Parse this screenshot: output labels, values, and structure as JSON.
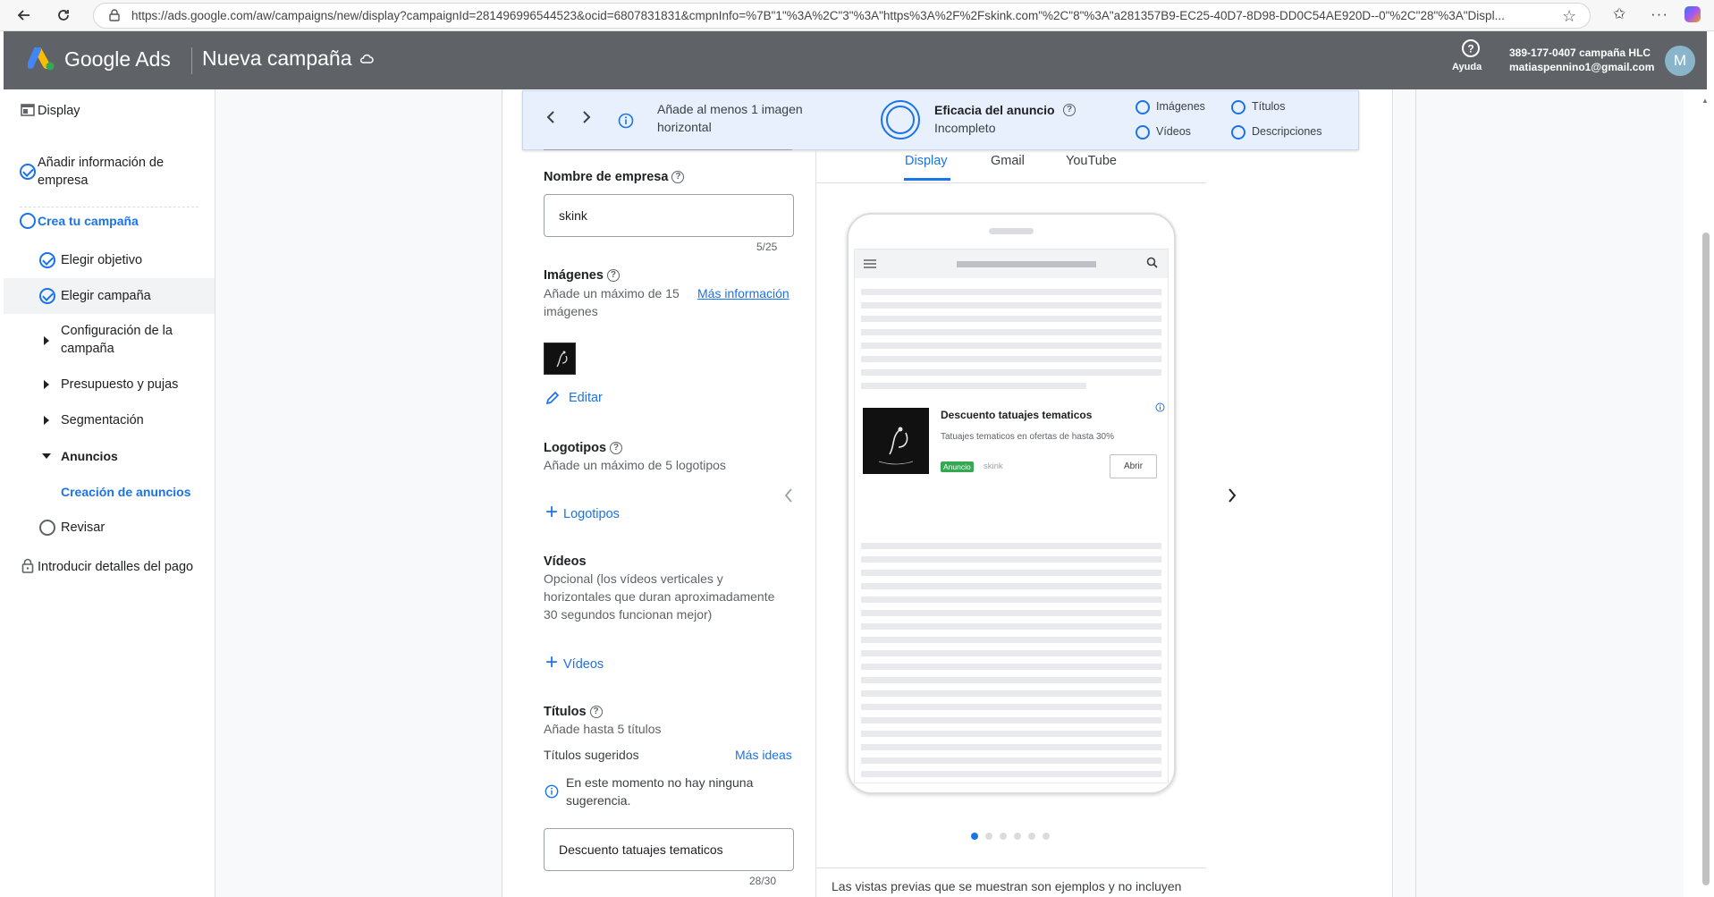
{
  "browser": {
    "url": "https://ads.google.com/aw/campaigns/new/display?campaignId=281496996544523&ocid=6807831831&cmpnInfo=%7B\"1\"%3A%2C\"3\"%3A\"https%3A%2F%2Fskink.com\"%2C\"8\"%3A\"a281357B9-EC25-40D7-8D98-DD0C54AE920D--0\"%2C\"28\"%3A\"Displ..."
  },
  "header": {
    "brand": "Google Ads",
    "campaign_title": "Nueva campaña",
    "help_label": "Ayuda",
    "account_line1": "389-177-0407 campaña HLC",
    "account_line2": "matiaspennino1@gmail.com",
    "avatar_letter": "M"
  },
  "sidebar": {
    "display": "Display",
    "business_info": [
      "Añadir información de",
      "empresa"
    ],
    "create_campaign": "Crea tu campaña",
    "choose_goal": "Elegir objetivo",
    "choose_campaign": "Elegir campaña",
    "campaign_settings": [
      "Configuración de la",
      "campaña"
    ],
    "budget_bidding": "Presupuesto y pujas",
    "targeting": "Segmentación",
    "ads": "Anuncios",
    "ad_creation": "Creación de anuncios",
    "review": "Revisar",
    "payment": "Introducir detalles del pago"
  },
  "banner": {
    "message_line1": "Añade al menos 1 imagen",
    "message_line2": "horizontal",
    "strength_label": "Eficacia del anuncio",
    "strength_value": "Incompleto",
    "checks": [
      "Imágenes",
      "Títulos",
      "Vídeos",
      "Descripciones"
    ]
  },
  "form": {
    "business_name_label": "Nombre de empresa",
    "business_name_value": "skink",
    "business_name_counter": "5/25",
    "images_label": "Imágenes",
    "images_sub_line1": "Añade un máximo de 15",
    "images_sub_line2": "imágenes",
    "more_info_link": "Más información",
    "edit_label": "Editar",
    "logos_label": "Logotipos",
    "logos_sub": "Añade un máximo de 5 logotipos",
    "logos_add": "Logotipos",
    "videos_label": "Vídeos",
    "videos_sub_line1": "Opcional (los vídeos verticales y",
    "videos_sub_line2": "horizontales que duran aproximadamente",
    "videos_sub_line3": "30 segundos funcionan mejor)",
    "videos_add": "Vídeos",
    "titles_label": "Títulos",
    "titles_sub": "Añade hasta 5 títulos",
    "suggested_titles": "Títulos sugeridos",
    "more_ideas": "Más ideas",
    "no_suggestion_line1": "En este momento no hay ninguna",
    "no_suggestion_line2": "sugerencia.",
    "title_value": "Descuento tatuajes tematicos",
    "title_counter": "28/30"
  },
  "preview": {
    "tabs": [
      "Display",
      "Gmail",
      "YouTube"
    ],
    "ad_headline": "Descuento tatuajes tematicos",
    "ad_description": "Tatuajes tematicos en ofertas de hasta 30%",
    "ad_badge": "Anuncio",
    "ad_business": "skink",
    "ad_button": "Abrir",
    "footer_note": "Las vistas previas que se muestran son ejemplos y no incluyen",
    "page_count": 6,
    "active_page": 1
  }
}
